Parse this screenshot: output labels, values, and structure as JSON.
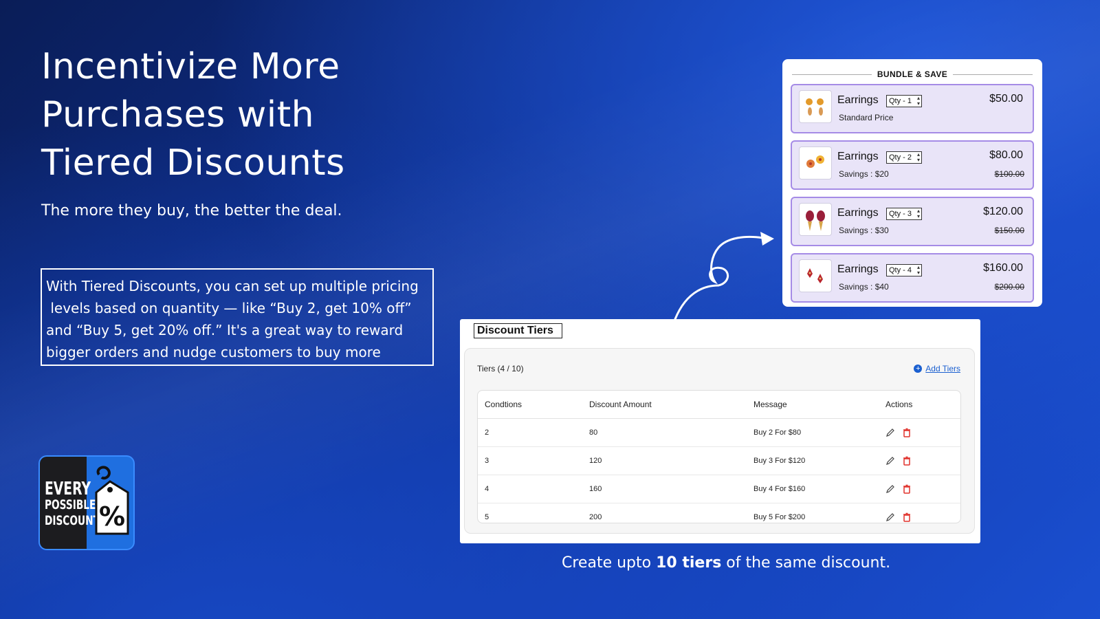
{
  "hero": {
    "title_line1": "Incentivize More",
    "title_line2": "Purchases with",
    "title_line3": "Tiered Discounts",
    "subtitle": "The more they buy, the better the deal.",
    "description_line1": "With Tiered Discounts, you can set up multiple pricing",
    "description_line2": " levels based on quantity — like “Buy 2, get 10% off”",
    "description_line3": "and “Buy 5, get 20% off.” It's a great way to reward",
    "description_line4": "bigger orders and nudge customers to buy more"
  },
  "logo": {
    "line1": "EVERY",
    "line2": "POSSIBLE",
    "line3": "DISCOUNT",
    "symbol": "%"
  },
  "bundle": {
    "header": "BUNDLE & SAVE",
    "tiers": [
      {
        "name": "Earrings",
        "qty": "Qty - 1",
        "note": "Standard Price",
        "price": "$50.00",
        "original_price": ""
      },
      {
        "name": "Earrings",
        "qty": "Qty - 2",
        "note": "Savings : $20",
        "price": "$80.00",
        "original_price": "$100.00"
      },
      {
        "name": "Earrings",
        "qty": "Qty - 3",
        "note": "Savings : $30",
        "price": "$120.00",
        "original_price": "$150.00"
      },
      {
        "name": "Earrings",
        "qty": "Qty - 4",
        "note": "Savings : $40",
        "price": "$160.00",
        "original_price": "$200.00"
      }
    ]
  },
  "discount_tiers": {
    "title": "Discount Tiers",
    "tiers_count": "Tiers (4 / 10)",
    "add_label": "Add Tiers",
    "columns": [
      "Condtions",
      "Discount Amount",
      "Message",
      "Actions"
    ],
    "rows": [
      {
        "condition": "2",
        "amount": "80",
        "message": "Buy 2 For $80"
      },
      {
        "condition": "3",
        "amount": "120",
        "message": "Buy 3 For $120"
      },
      {
        "condition": "4",
        "amount": "160",
        "message": "Buy 4 For $160"
      },
      {
        "condition": "5",
        "amount": "200",
        "message": "Buy 5 For $200"
      }
    ]
  },
  "caption": {
    "prefix": "Create upto ",
    "bold": "10 tiers",
    "suffix": " of the same discount."
  },
  "icons": [
    "edit-icon",
    "trash-icon",
    "plus-circle-icon",
    "curved-arrow-icon",
    "price-tag-icon",
    "earring-thumbnail"
  ],
  "colors": {
    "background": "#0e2f8f",
    "tier_fill": "#e9e4f8",
    "tier_border": "#a58be6",
    "link": "#1a5fd0",
    "delete": "#e0302a"
  }
}
